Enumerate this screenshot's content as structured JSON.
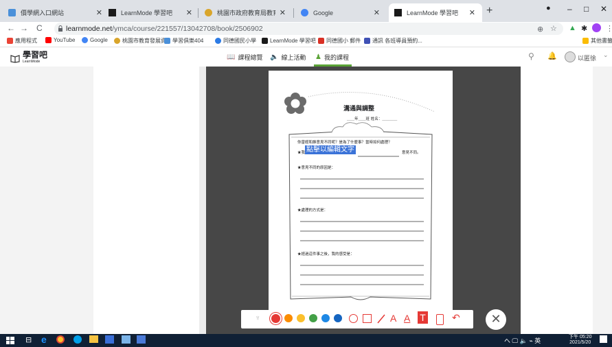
{
  "browser": {
    "tabs": [
      {
        "title": "價學網入口網站",
        "fav_color": "#4a90d9",
        "active": false
      },
      {
        "title": "LearnMode 學習吧",
        "fav_color": "#1a1a1a",
        "active": false
      },
      {
        "title": "桃園市政府教育局教育公務單一",
        "fav_color": "#d9a52b",
        "active": false
      },
      {
        "title": "Google",
        "fav_color": "#4285f4",
        "active": false
      },
      {
        "title": "LearnMode 學習吧",
        "fav_color": "#1a1a1a",
        "active": true
      }
    ],
    "new_tab": "+",
    "window_controls": {
      "minimize": "–",
      "maximize": "□",
      "close": "✕"
    },
    "nav": {
      "back": "←",
      "forward": "→",
      "reload": "C"
    },
    "url_domain": "learnmode.net",
    "url_path": "/ymca/course/221557/13042708/book/2506902",
    "bookmarks": [
      {
        "label": "應用程式",
        "color": "#ea4335"
      },
      {
        "label": "YouTube",
        "color": "#ff0000"
      },
      {
        "label": "Google",
        "color": "#4285f4"
      },
      {
        "label": "桃園市教育發展資...",
        "color": "#d9a52b"
      },
      {
        "label": "學習俱樂404",
        "color": "#4a90d9"
      },
      {
        "label": "同德國民小學",
        "color": "#2c7be5"
      },
      {
        "label": "LearnMode 學習吧",
        "color": "#1a1a1a"
      },
      {
        "label": "同德國小 郵件",
        "color": "#d93025"
      },
      {
        "label": "通訊 各班導員預約...",
        "color": "#3f51b5"
      }
    ],
    "other_bookmarks": "其他書籤"
  },
  "site": {
    "logo": "學習吧",
    "logo_sub": "LearnMode",
    "nav": [
      {
        "label": "課程總覽",
        "icon": "book-icon"
      },
      {
        "label": "線上活動",
        "icon": "speaker-icon"
      },
      {
        "label": "我的課程",
        "icon": "reading-icon"
      }
    ],
    "user": "以匿徐",
    "chevron": "⌄"
  },
  "worksheet": {
    "title": "溝通與調整",
    "class_line": "＿＿年＿＿班  姓名：＿＿＿＿",
    "question": "你曾經和誰意見不同呢？是為了什麼事？當時如何處理？",
    "row1_prefix": "★我曾經和",
    "row1_suffix": "意見不同。",
    "edit_hint": "點擊以編輯文字",
    "q2": "★意見不同的原因是：",
    "q3": "★處理的方式是：",
    "q4": "★經過這件事之後，我的感受是："
  },
  "toolbar": {
    "colors": [
      "#e53935",
      "#fb8c00",
      "#fbc02d",
      "#43a047",
      "#1e88e5",
      "#1565c0"
    ],
    "tools": [
      "circle-tool",
      "rect-tool",
      "line-tool",
      "text-a-tool",
      "text-a2-tool",
      "text-t-tool",
      "eraser-tool",
      "undo-tool"
    ],
    "close": "✕"
  },
  "taskbar": {
    "tray": "へ 🖵 🔈 ⌁ 英",
    "time": "下午 05:20",
    "date": "2021/5/20"
  }
}
